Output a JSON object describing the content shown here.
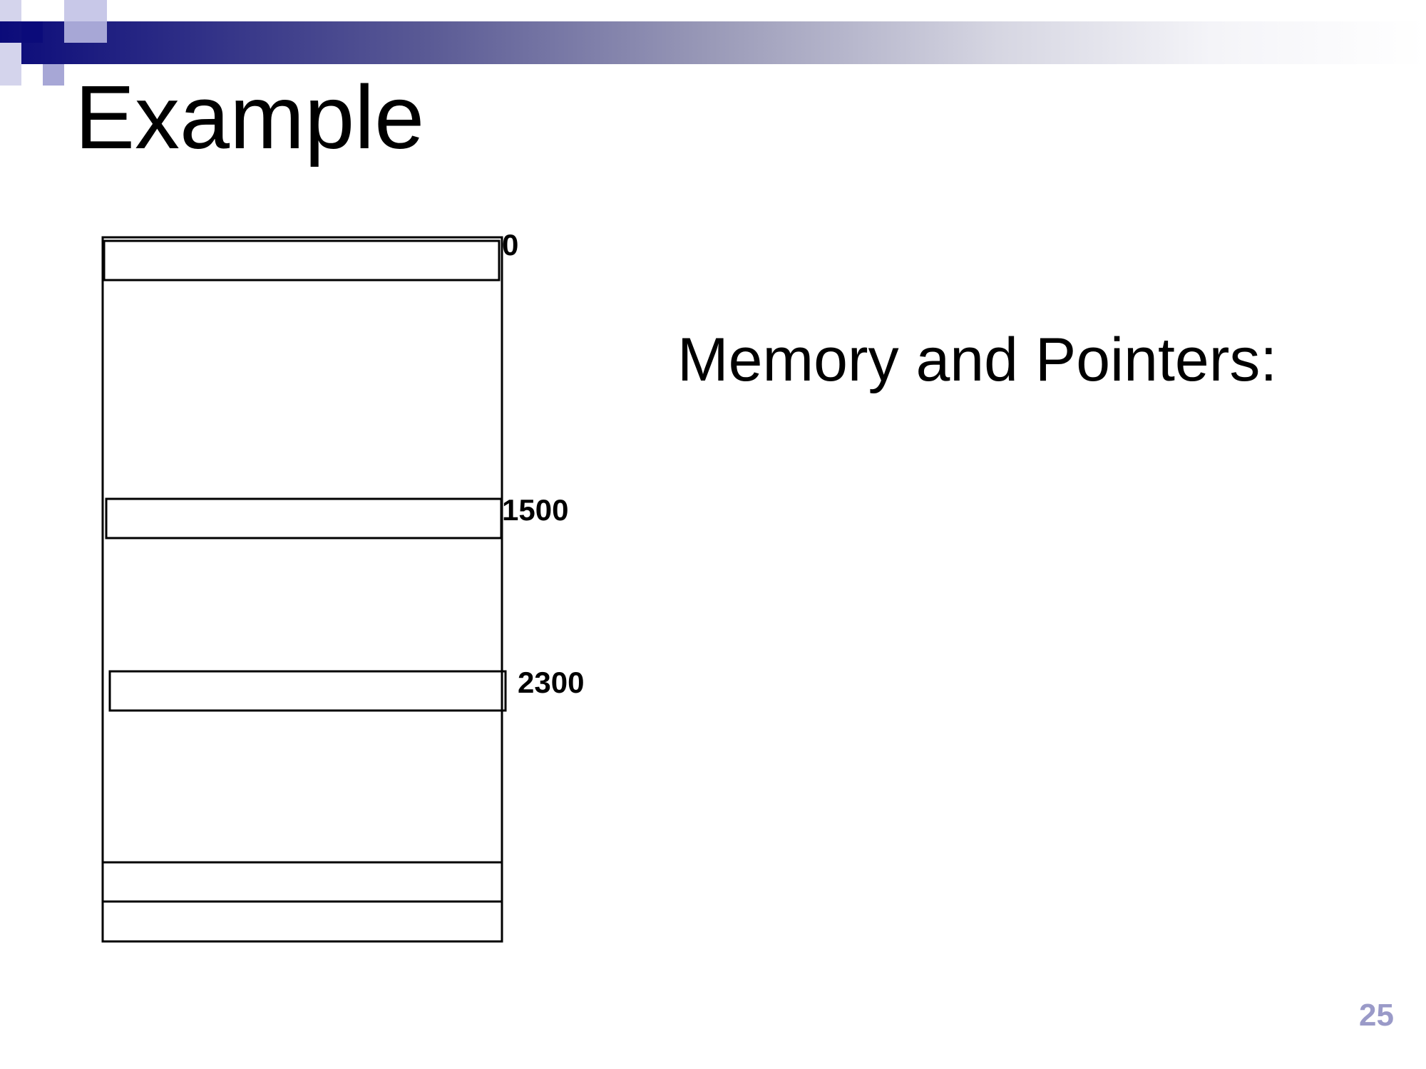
{
  "slide": {
    "title": "Example",
    "subtitle": "Memory and Pointers:",
    "page_number": "25"
  },
  "memory": {
    "addresses": [
      {
        "label": "0"
      },
      {
        "label": "1500"
      },
      {
        "label": "2300"
      }
    ]
  },
  "colors": {
    "header_dark": "#0b0b7a",
    "header_mid": "#9a9ab8",
    "deco_navy": "#0b0b7a",
    "deco_lavender": "#a7a7d6",
    "page_number": "#9a9ac8",
    "outline": "#000000"
  }
}
